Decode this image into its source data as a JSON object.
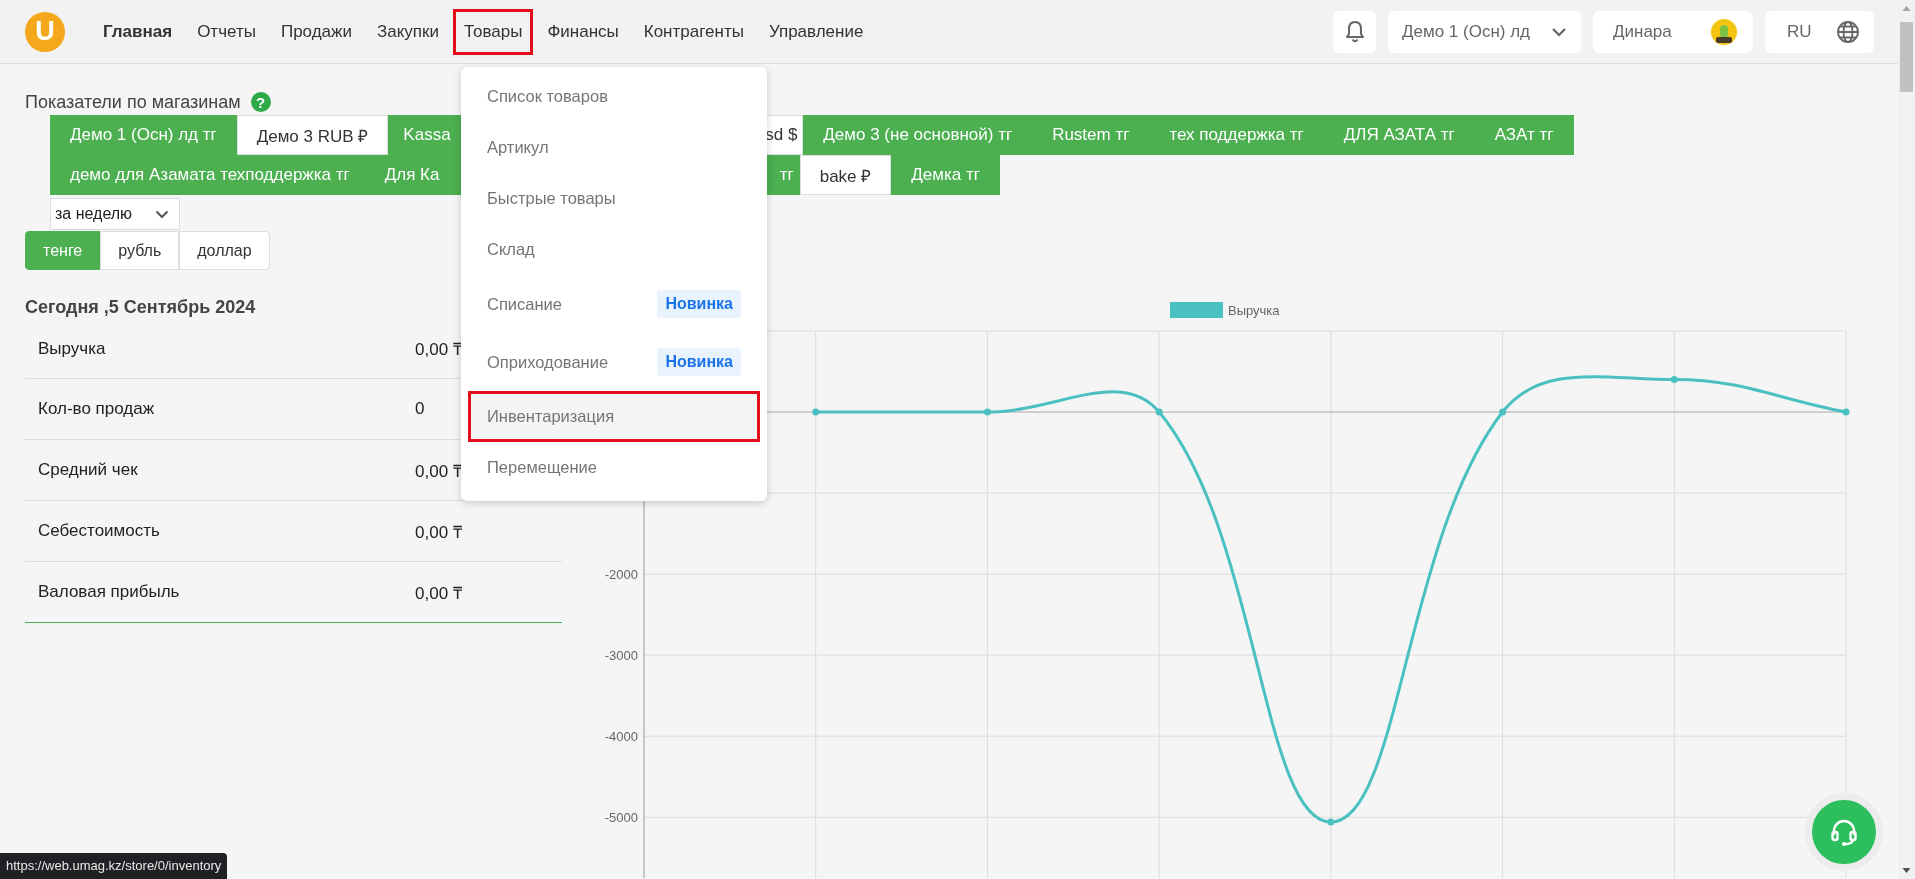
{
  "logo": {
    "text": "U"
  },
  "nav": [
    {
      "label": "Главная",
      "selected": true,
      "highlighted": false
    },
    {
      "label": "Отчеты",
      "selected": false,
      "highlighted": false
    },
    {
      "label": "Продажи",
      "selected": false,
      "highlighted": false
    },
    {
      "label": "Закупки",
      "selected": false,
      "highlighted": false
    },
    {
      "label": "Товары",
      "selected": false,
      "highlighted": true
    },
    {
      "label": "Финансы",
      "selected": false,
      "highlighted": false
    },
    {
      "label": "Контрагенты",
      "selected": false,
      "highlighted": false
    },
    {
      "label": "Управление",
      "selected": false,
      "highlighted": false
    }
  ],
  "store_select": {
    "value": "Демо 1 (Осн) лд"
  },
  "user": {
    "name": "Динара"
  },
  "language": {
    "value": "RU"
  },
  "section_title": {
    "text": "Показатели по магазинам",
    "help": "?"
  },
  "store_tab_rows": [
    {
      "tabs": [
        {
          "label": "Демо 1 (Осн) лд тг",
          "selected": true,
          "kind": "full"
        },
        {
          "label": "Демо 3 RUB ₽",
          "selected": false,
          "kind": "full"
        },
        {
          "label": "Kassa",
          "selected": true,
          "kind": "cut-end"
        },
        {
          "label": "sd $",
          "selected": false,
          "kind": "cut-start"
        },
        {
          "label": "Демо 3 (не основной) тг",
          "selected": true,
          "kind": "full"
        },
        {
          "label": "Rustem тг",
          "selected": true,
          "kind": "full"
        },
        {
          "label": "тех поддержка тг",
          "selected": true,
          "kind": "full"
        },
        {
          "label": "ДЛЯ АЗАТА тг",
          "selected": true,
          "kind": "full"
        },
        {
          "label": "АЗАт тг",
          "selected": true,
          "kind": "full"
        }
      ]
    },
    {
      "tabs": [
        {
          "label": "демо для Азамата техподдержка тг",
          "selected": true,
          "kind": "full"
        },
        {
          "label": "Для Ка",
          "selected": true,
          "kind": "cut-end"
        },
        {
          "label": "тг",
          "selected": true,
          "kind": "cut-start"
        },
        {
          "label": "bake ₽",
          "selected": false,
          "kind": "full"
        },
        {
          "label": "Демка тг",
          "selected": true,
          "kind": "full"
        }
      ]
    }
  ],
  "period_select": {
    "value": "за неделю"
  },
  "currencies": [
    {
      "label": "тенге",
      "selected": true
    },
    {
      "label": "рубль",
      "selected": false
    },
    {
      "label": "доллар",
      "selected": false
    }
  ],
  "today_title": "Сегодня ,5 Сентябрь 2024",
  "stats": [
    {
      "label": "Выручка",
      "value": "0,00 ₸"
    },
    {
      "label": "Кол-во продаж",
      "value": "0"
    },
    {
      "label": "Средний чек",
      "value": "0,00 ₸"
    },
    {
      "label": "Себестоимость",
      "value": "0,00 ₸"
    },
    {
      "label": "Валовая прибыль",
      "value": "0,00 ₸"
    }
  ],
  "chart_data": {
    "type": "line",
    "ylim": [
      -5750,
      1000
    ],
    "yticks": [
      -2000,
      -3000,
      -4000,
      -5000
    ],
    "grid": true,
    "series": [
      {
        "name": "Выручка",
        "color": "#4bc0c0",
        "marker": true,
        "values": [
          null,
          0,
          0,
          0,
          -5060,
          0,
          400,
          0
        ]
      }
    ]
  },
  "menu": {
    "items": [
      {
        "label": "Список товаров",
        "highlighted": false
      },
      {
        "label": "Артикул",
        "highlighted": false
      },
      {
        "label": "Быстрые товары",
        "highlighted": false
      },
      {
        "label": "Склад",
        "highlighted": false
      },
      {
        "label": "Списание",
        "badge": "Новинка",
        "highlighted": false
      },
      {
        "label": "Оприходование",
        "badge": "Новинка",
        "highlighted": false
      },
      {
        "label": "Инвентаризация",
        "highlighted": true
      },
      {
        "label": "Перемещение",
        "highlighted": false
      }
    ]
  },
  "status_url": "https://web.umag.kz/store/0/inventory"
}
